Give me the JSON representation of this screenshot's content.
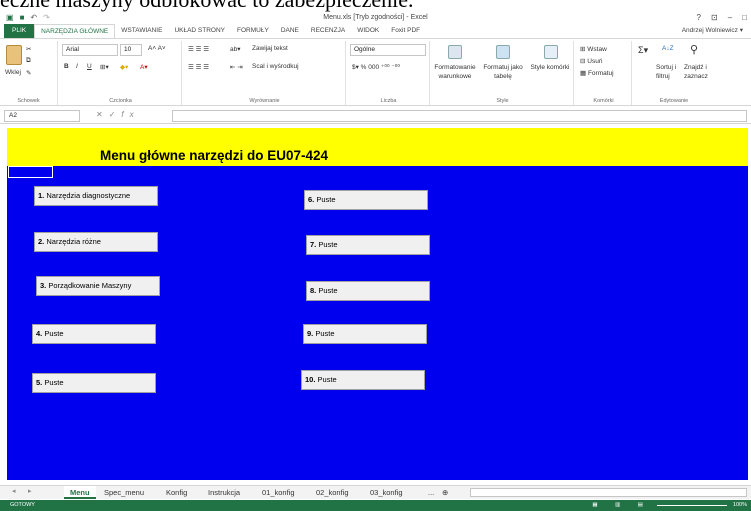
{
  "caption": "eczne maszyny odblokować to zabezpieczenie.",
  "window": {
    "title": "Menu.xls [Tryb zgodności] - Excel",
    "controls": [
      "?",
      "⊡",
      "–",
      "□"
    ]
  },
  "ribbon_tabs": {
    "file": "PLIK",
    "tabs": [
      "NARZĘDZIA GŁÓWNE",
      "WSTAWIANIE",
      "UKŁAD STRONY",
      "FORMUŁY",
      "DANE",
      "RECENZJA",
      "WIDOK",
      "Foxit PDF"
    ],
    "user": "Andrzej Wolniewicz ▾"
  },
  "ribbon": {
    "clipboard": {
      "paste": "Wklej",
      "label": "Schowek"
    },
    "font": {
      "name": "Arial",
      "size": "10",
      "label": "Czcionka",
      "bold": "B",
      "italic": "I",
      "underline": "U"
    },
    "alignment": {
      "wrap": "Zawijaj tekst",
      "merge": "Scal i wyśrodkuj",
      "label": "Wyrównanie"
    },
    "number": {
      "format": "Ogólne",
      "label": "Liczba"
    },
    "styles": {
      "conditional": "Formatowanie warunkowe",
      "table": "Formatuj jako tabelę",
      "cell": "Style komórki",
      "label": "Style"
    },
    "cells": {
      "insert": "Wstaw",
      "delete": "Usuń",
      "format": "Formatuj",
      "label": "Komórki"
    },
    "editing": {
      "sort": "Sortuj i filtruj",
      "find": "Znajdź i zaznacz",
      "label": "Edytowanie"
    }
  },
  "formula_bar": {
    "cell_ref": "A2",
    "fx": "fx",
    "value": ""
  },
  "sheet": {
    "title": "Menu główne narzędzi do EU07-424",
    "buttons_left": [
      {
        "num": "1.",
        "label": "Narzędzia diagnostyczne"
      },
      {
        "num": "2.",
        "label": "Narzędzia różne"
      },
      {
        "num": "3.",
        "label": "Porządkowanie Maszyny"
      },
      {
        "num": "4.",
        "label": "Puste"
      },
      {
        "num": "5.",
        "label": "Puste"
      }
    ],
    "buttons_right": [
      {
        "num": "6.",
        "label": "Puste"
      },
      {
        "num": "7.",
        "label": "Puste"
      },
      {
        "num": "8.",
        "label": "Puste"
      },
      {
        "num": "9.",
        "label": "Puste"
      },
      {
        "num": "10.",
        "label": "Puste"
      }
    ]
  },
  "sheet_tabs": [
    "Menu",
    "Spec_menu",
    "Konfig",
    "Instrukcja",
    "01_konfig",
    "02_konfig",
    "03_konfig",
    "..."
  ],
  "status": {
    "ready": "GOTOWY",
    "zoom": "100%"
  },
  "colors": {
    "excel_green": "#217346",
    "sheet_bg": "#0000ee",
    "banner": "#ffff00"
  }
}
